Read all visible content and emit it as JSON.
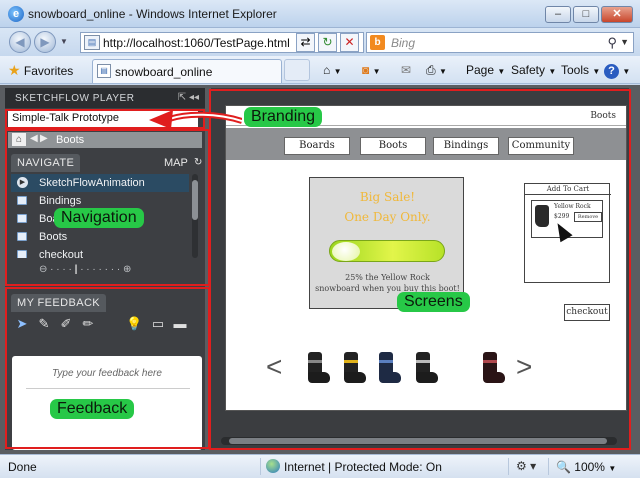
{
  "window": {
    "title": "snowboard_online - Windows Internet Explorer",
    "min_glyph": "–",
    "max_glyph": "□",
    "close_glyph": "✕"
  },
  "address_bar": {
    "url": "http://localhost:1060/TestPage.html",
    "search_placeholder": "Bing"
  },
  "favorites_bar": {
    "favorites_label": "Favorites",
    "tab_title": "snowboard_online"
  },
  "command_bar": {
    "page": "Page",
    "safety": "Safety",
    "tools": "Tools",
    "help": "?"
  },
  "player": {
    "header": "SKETCHFLOW PLAYER",
    "prototype_title": "Simple-Talk Prototype",
    "breadcrumb": "Boots",
    "navigate_tab": "NAVIGATE",
    "map_label": "MAP",
    "nav_items": [
      {
        "label": "SketchFlowAnimation",
        "type": "animation"
      },
      {
        "label": "Bindings",
        "type": "screen"
      },
      {
        "label": "Boards",
        "type": "screen"
      },
      {
        "label": "Boots",
        "type": "screen"
      },
      {
        "label": "checkout",
        "type": "screen"
      }
    ],
    "feedback_tab": "MY FEEDBACK",
    "feedback_placeholder": "Type your feedback here"
  },
  "screen": {
    "corner_label": "Boots",
    "nav_tabs": [
      "Boards",
      "Boots",
      "Bindings",
      "Community"
    ],
    "sale_line1": "Big Sale!",
    "sale_line2": "One Day Only.",
    "sale_desc_line1": "25% the Yellow Rock",
    "sale_desc_line2": "snowboard when you buy this boot!",
    "cart_title": "Add To Cart",
    "cart_item_name": "Yellow Rock",
    "cart_item_price": "$299",
    "cart_remove": "Remove",
    "checkout": "checkout"
  },
  "annotations": {
    "branding": "Branding",
    "navigation": "Navigation",
    "screens": "Screens",
    "feedback": "Feedback"
  },
  "status_bar": {
    "status": "Done",
    "zone": "Internet | Protected Mode: On",
    "zoom": "100%"
  },
  "colors": {
    "annotation_red": "#e01e1e",
    "annotation_green": "#27c847",
    "sale_text": "#f0b83a",
    "board_green": "#9bd61e"
  }
}
